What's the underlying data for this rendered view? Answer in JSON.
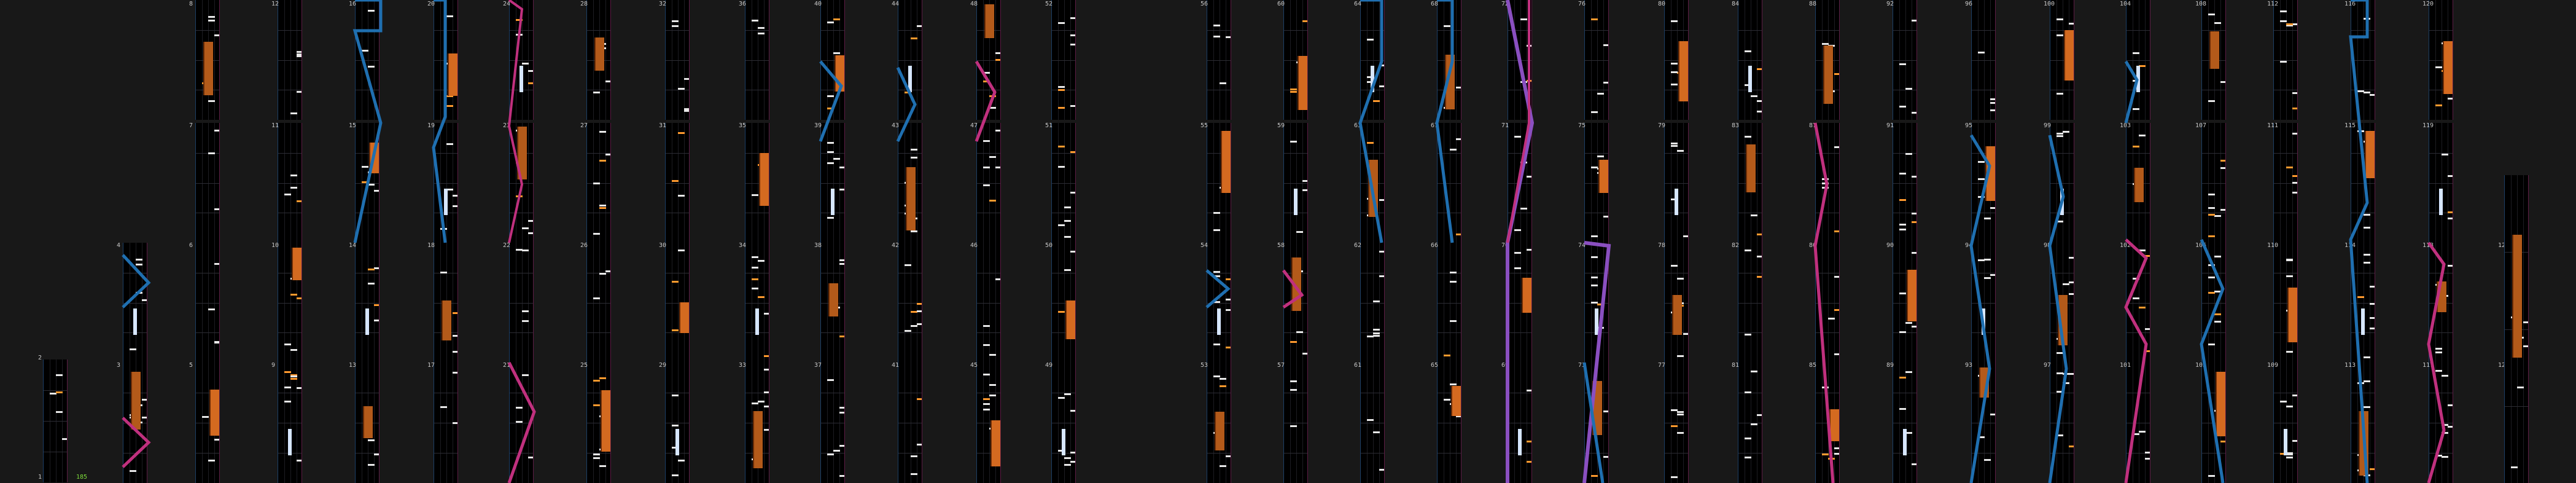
{
  "colors": {
    "background": "#181818",
    "column": "#000000",
    "tap": "#e8e8e8",
    "tap_accent": "#ff9a2e",
    "hold": "#b35a1a",
    "slide": "#d6e6ff",
    "laser_blue": "#1f6fb0",
    "laser_pink": "#c0307e",
    "laser_purple": "#8a4fc0",
    "label_green": "#7ddc3a"
  },
  "measure_labels": [
    "1",
    "2",
    "3",
    "4",
    "5",
    "6",
    "7",
    "8",
    "9",
    "10",
    "11",
    "12",
    "13",
    "14",
    "15",
    "16",
    "17",
    "18",
    "19",
    "20",
    "21",
    "22",
    "23",
    "24",
    "25",
    "26",
    "27",
    "28",
    "29",
    "30",
    "31",
    "32",
    "33",
    "34",
    "35",
    "36",
    "37",
    "38",
    "39",
    "40",
    "41",
    "42",
    "43",
    "44",
    "45",
    "46",
    "47",
    "48",
    "49",
    "50",
    "51",
    "52",
    "53",
    "54",
    "55",
    "56",
    "57",
    "58",
    "59",
    "60",
    "61",
    "62",
    "63",
    "64",
    "65",
    "66",
    "67",
    "68",
    "69",
    "70",
    "71",
    "72",
    "73",
    "74",
    "75",
    "76",
    "77",
    "78",
    "79",
    "80",
    "81",
    "82",
    "83",
    "84",
    "85",
    "86",
    "87",
    "88",
    "89",
    "90",
    "91",
    "92",
    "93",
    "94",
    "95",
    "96",
    "97",
    "98",
    "99",
    "100",
    "101",
    "102",
    "103",
    "104",
    "105",
    "106",
    "107",
    "108",
    "109",
    "110",
    "111",
    "112",
    "113",
    "114",
    "115",
    "116",
    "117",
    "118",
    "119",
    "120",
    "121",
    "122"
  ],
  "bpm_marker": "185",
  "lasers": [
    {
      "name": "laser-left",
      "color": "blue",
      "icon": "laser-left-icon"
    },
    {
      "name": "laser-right",
      "color": "pink",
      "icon": "laser-right-icon"
    },
    {
      "name": "laser-center",
      "color": "purple",
      "icon": "laser-center-icon"
    }
  ]
}
